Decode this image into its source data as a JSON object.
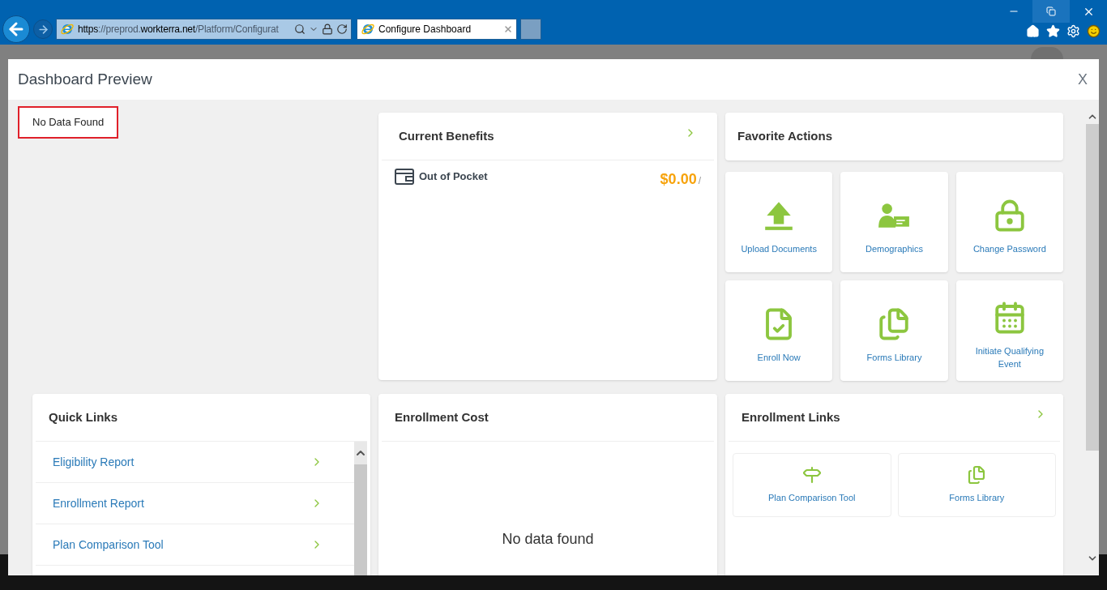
{
  "browser": {
    "url_parts": [
      {
        "text": "https",
        "strong": true
      },
      {
        "text": "://preprod.",
        "strong": false
      },
      {
        "text": "workterra.net",
        "strong": true
      },
      {
        "text": "/Platform/Configurat",
        "strong": false
      }
    ],
    "tabs": [
      {
        "title": "Configure Dashboard",
        "selected": true
      }
    ]
  },
  "dialog": {
    "title": "Dashboard Preview",
    "close": "X",
    "notice": "No Data Found",
    "current_benefits": {
      "title": "Current Benefits",
      "items": [
        {
          "label": "Out of Pocket",
          "amount": "$0.00",
          "suffix": "/"
        }
      ]
    },
    "favorite_actions": {
      "title": "Favorite Actions",
      "tiles": [
        {
          "label": "Upload Documents",
          "kind": "upload"
        },
        {
          "label": "Demographics",
          "kind": "person-card"
        },
        {
          "label": "Change Password",
          "kind": "lock"
        },
        {
          "label": "Enroll Now",
          "kind": "enroll"
        },
        {
          "label": "Forms Library",
          "kind": "forms"
        },
        {
          "label": "Initiate Qualifying Event",
          "kind": "calendar"
        }
      ]
    },
    "quick_links": {
      "title": "Quick Links",
      "items": [
        "Eligibility Report",
        "Enrollment Report",
        "Plan Comparison Tool"
      ]
    },
    "enrollment_cost": {
      "title": "Enrollment Cost",
      "empty": "No data found"
    },
    "enrollment_links": {
      "title": "Enrollment Links",
      "tiles": [
        {
          "label": "Plan Comparison Tool",
          "kind": "signpost"
        },
        {
          "label": "Forms Library",
          "kind": "forms"
        }
      ]
    }
  }
}
